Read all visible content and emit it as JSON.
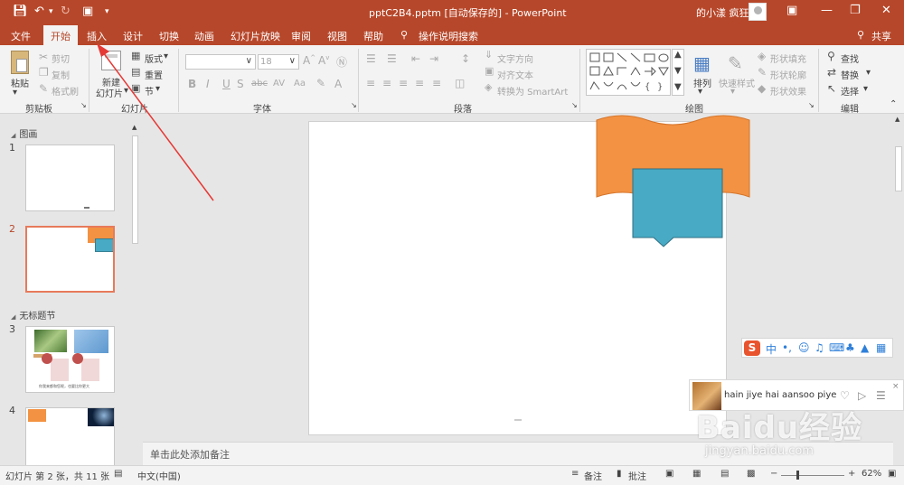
{
  "window": {
    "title": "pptC2B4.pptm [自动保存的] - PowerPoint",
    "user": "的小漾 疯狂",
    "quick_access": [
      "save-icon",
      "undo-icon",
      "redo-icon",
      "slideshow-from-start-icon",
      "customize-qat-icon"
    ],
    "controls": [
      "ribbon-display-icon",
      "minimize-icon",
      "restore-icon",
      "close-icon"
    ]
  },
  "tabs": [
    {
      "label": "文件",
      "active": false
    },
    {
      "label": "开始",
      "active": true
    },
    {
      "label": "插入",
      "active": false
    },
    {
      "label": "设计",
      "active": false
    },
    {
      "label": "切换",
      "active": false
    },
    {
      "label": "动画",
      "active": false
    },
    {
      "label": "幻灯片放映",
      "active": false
    },
    {
      "label": "审阅",
      "active": false
    },
    {
      "label": "视图",
      "active": false
    },
    {
      "label": "帮助",
      "active": false
    },
    {
      "label": "操作说明搜索",
      "active": false
    }
  ],
  "share_label": "共享",
  "ribbon": {
    "clipboard": {
      "group": "剪贴板",
      "paste": "粘贴",
      "cut": "剪切",
      "copy": "复制",
      "format_painter": "格式刷"
    },
    "slides": {
      "group": "幻灯片",
      "new_slide_1": "新建",
      "new_slide_2": "幻灯片",
      "layout": "版式",
      "reset": "重置",
      "section": "节"
    },
    "font": {
      "group": "字体",
      "font_name": "",
      "font_size": "18",
      "buttons": [
        "B",
        "I",
        "U",
        "S",
        "abc",
        "AV",
        "Aa"
      ]
    },
    "paragraph": {
      "group": "段落",
      "text_direction": "文字方向",
      "align_text": "对齐文本",
      "smartart": "转换为 SmartArt"
    },
    "drawing": {
      "group": "绘图",
      "arrange": "排列",
      "quick_styles": "快速样式",
      "shape_fill": "形状填充",
      "shape_outline": "形状轮廓",
      "shape_effects": "形状效果"
    },
    "editing": {
      "group": "编辑",
      "find": "查找",
      "replace": "替换",
      "select": "选择"
    }
  },
  "left_pane": {
    "sections": [
      {
        "name": "图画"
      },
      {
        "name": "无标题节"
      }
    ],
    "slides": [
      {
        "number": "1",
        "selected": false
      },
      {
        "number": "2",
        "selected": true
      },
      {
        "number": "3",
        "selected": false,
        "caption": "你我来都和您呢，也要比你更大"
      },
      {
        "number": "4",
        "selected": false
      }
    ]
  },
  "notes_placeholder": "单击此处添加备注",
  "statusbar": {
    "slide_info": "幻灯片 第 2 张，共 11 张",
    "language": "中文(中国)",
    "notes": "备注",
    "comments": "批注",
    "zoom": "62%",
    "zoom_minus": "−",
    "zoom_plus": "+"
  },
  "ime": {
    "logo": "S",
    "mode": "中",
    "icons": [
      "punctuation-icon",
      "emoji-icon",
      "microphone-icon",
      "keyboard-icon",
      "skin-icon",
      "shirt-icon",
      "grid-icon"
    ]
  },
  "music": {
    "song": "hain jiye hai aansoo piye"
  },
  "watermark": {
    "brand": "Baidu经验",
    "url": "jingyan.baidu.com"
  },
  "colors": {
    "accent": "#b7472a",
    "slide_orange": "#f39242",
    "slide_teal": "#48aac5",
    "annotation_arrow": "#e53935"
  }
}
